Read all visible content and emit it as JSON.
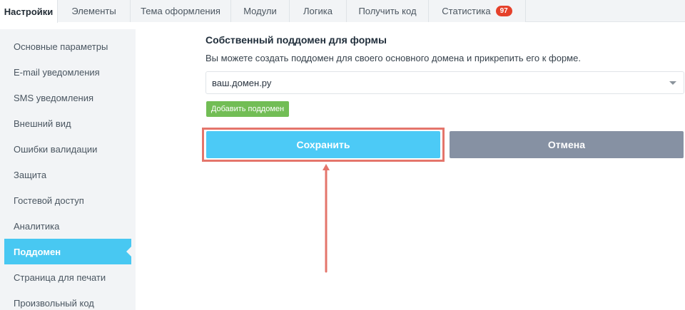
{
  "tabs": [
    {
      "label": "Настройки",
      "active": true
    },
    {
      "label": "Элементы"
    },
    {
      "label": "Тема оформления"
    },
    {
      "label": "Модули"
    },
    {
      "label": "Логика"
    },
    {
      "label": "Получить код"
    },
    {
      "label": "Статистика",
      "badge": "97"
    }
  ],
  "sidebar": {
    "items": [
      {
        "label": "Основные параметры"
      },
      {
        "label": "E-mail уведомления"
      },
      {
        "label": "SMS уведомления"
      },
      {
        "label": "Внешний вид"
      },
      {
        "label": "Ошибки валидации"
      },
      {
        "label": "Защита"
      },
      {
        "label": "Гостевой доступ"
      },
      {
        "label": "Аналитика"
      },
      {
        "label": "Поддомен",
        "active": true
      },
      {
        "label": "Страница для печати"
      },
      {
        "label": "Произвольный код"
      }
    ]
  },
  "main": {
    "title": "Собственный поддомен для формы",
    "description": "Вы можете создать поддомен для своего основного домена и прикрепить его к форме.",
    "domain_select_value": "ваш.домен.ру",
    "add_subdomain_label": "Добавить поддомен",
    "save_label": "Сохранить",
    "cancel_label": "Отмена"
  },
  "colors": {
    "accent": "#48c8f2",
    "save": "#4ccaf6",
    "cancel": "#8691a3",
    "add": "#72bd55",
    "badge": "#e5412b",
    "annotation": "#e4756b"
  }
}
